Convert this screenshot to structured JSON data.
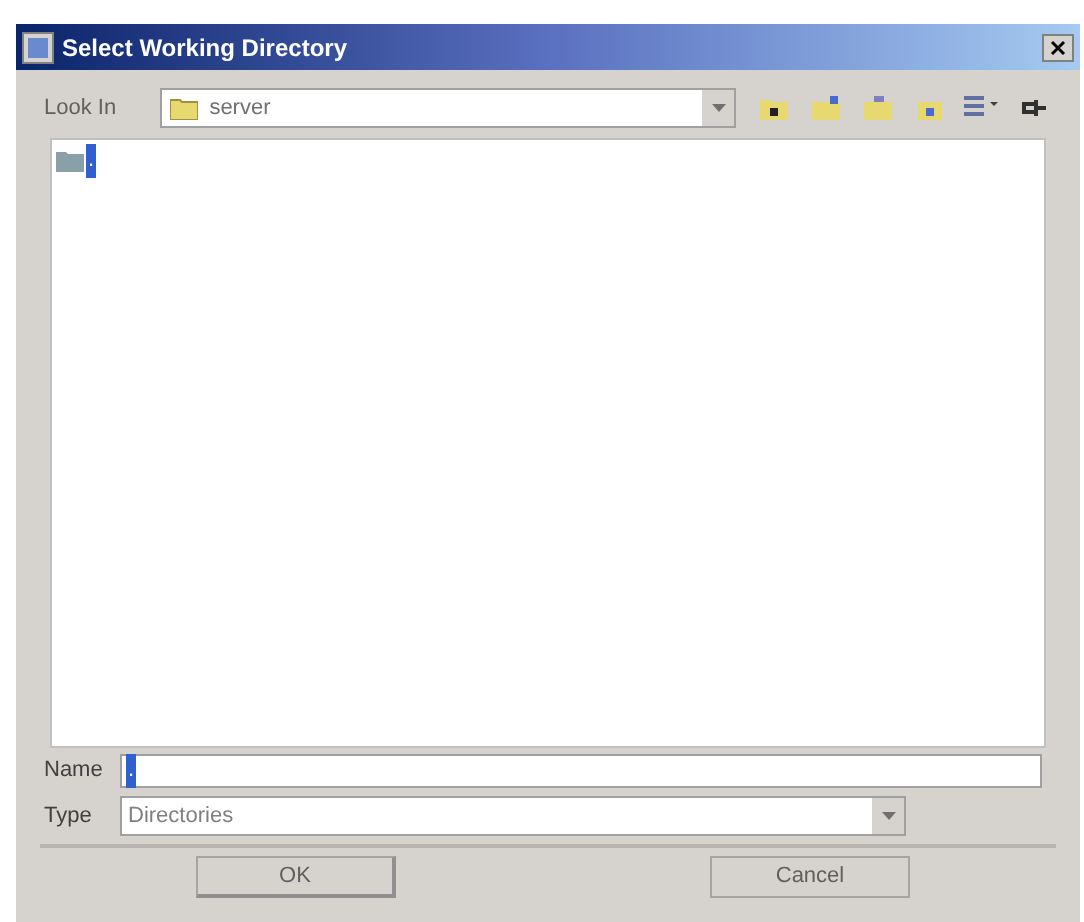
{
  "window": {
    "title": "Select Working Directory"
  },
  "look_in": {
    "label": "Look In",
    "value": "server"
  },
  "file_list": {
    "items": [
      {
        "name": ".",
        "selected": true
      }
    ]
  },
  "name_field": {
    "label": "Name",
    "value": "."
  },
  "type_field": {
    "label": "Type",
    "value": "Directories"
  },
  "buttons": [
    {
      "label": "OK"
    },
    {
      "label": "Cancel"
    }
  ]
}
